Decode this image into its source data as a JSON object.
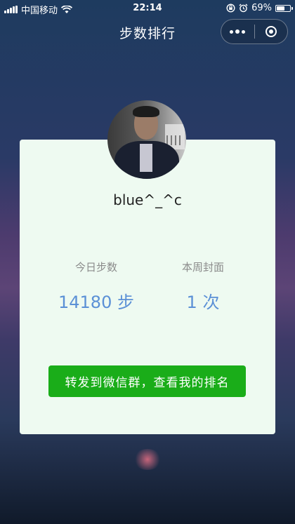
{
  "status_bar": {
    "carrier": "中国移动",
    "time": "22:14",
    "battery_percent": "69%",
    "battery_level": 0.69
  },
  "nav": {
    "title": "步数排行"
  },
  "profile": {
    "username": "blue^_^c"
  },
  "stats": {
    "today_label": "今日步数",
    "today_value": "14180 步",
    "week_label": "本周封面",
    "week_value": "1 次"
  },
  "actions": {
    "share_label": "转发到微信群，查看我的排名"
  },
  "colors": {
    "card_bg": "#eefaf1",
    "accent_blue": "#5b90d6",
    "button_green": "#1aad19"
  }
}
